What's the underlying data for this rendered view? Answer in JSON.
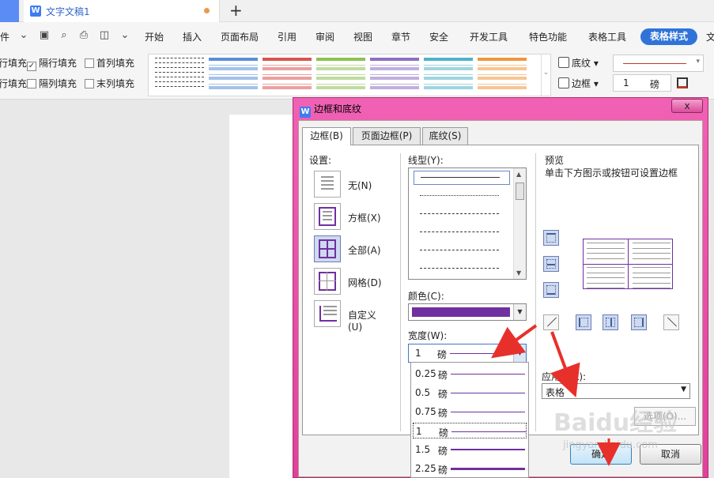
{
  "tabbar": {
    "doc_title": "文字文稿1",
    "logo": "W",
    "new_tab": "+"
  },
  "menubar": {
    "file": "件",
    "items": [
      "开始",
      "插入",
      "页面布局",
      "引用",
      "审阅",
      "视图",
      "章节",
      "安全",
      "开发工具",
      "特色功能",
      "表格工具"
    ],
    "active": "表格样式",
    "last": "文"
  },
  "ribbon": {
    "row1": [
      {
        "label": "行填充",
        "checked": false
      },
      {
        "label": "隔行填充",
        "checked": true
      },
      {
        "label": "首列填充",
        "checked": false
      }
    ],
    "row2": [
      {
        "label": "行填充",
        "checked": false
      },
      {
        "label": "隔列填充",
        "checked": false
      },
      {
        "label": "末列填充",
        "checked": false
      }
    ],
    "shading": "底纹",
    "border": "边框",
    "line_width_value": "1",
    "line_width_unit": "磅",
    "style_colors": [
      "#ffffff",
      "#5b8fd6",
      "#d9534f",
      "#8cc152",
      "#8e6fc2",
      "#4fb3c9",
      "#f0963d"
    ]
  },
  "dialog": {
    "title": "边框和底纹",
    "close": "x",
    "tabs": [
      "边框(B)",
      "页面边框(P)",
      "底纹(S)"
    ],
    "settings_label": "设置:",
    "settings": [
      {
        "label": "无(N)"
      },
      {
        "label": "方框(X)"
      },
      {
        "label": "全部(A)"
      },
      {
        "label": "网格(D)"
      },
      {
        "label": "自定义(U)"
      }
    ],
    "linestyle_label": "线型(Y):",
    "color_label": "颜色(C):",
    "color_value": "#7030a0",
    "width_label": "宽度(W):",
    "width_value": "1",
    "width_unit": "磅",
    "width_options": [
      {
        "value": "0.25",
        "unit": "磅",
        "weight": 1
      },
      {
        "value": "0.5",
        "unit": "磅",
        "weight": 1
      },
      {
        "value": "0.75",
        "unit": "磅",
        "weight": 1
      },
      {
        "value": "1",
        "unit": "磅",
        "weight": 1
      },
      {
        "value": "1.5",
        "unit": "磅",
        "weight": 2
      },
      {
        "value": "2.25",
        "unit": "磅",
        "weight": 3
      }
    ],
    "preview_label": "预览",
    "preview_hint": "单击下方图示或按钮可设置边框",
    "apply_label": "应用于(L):",
    "apply_value": "表格",
    "options_button": "选项(O)...",
    "ok_button": "确定",
    "cancel_button": "取消"
  },
  "watermark": {
    "main": "Baidu经验",
    "sub": "jingyan.baidu.com"
  }
}
